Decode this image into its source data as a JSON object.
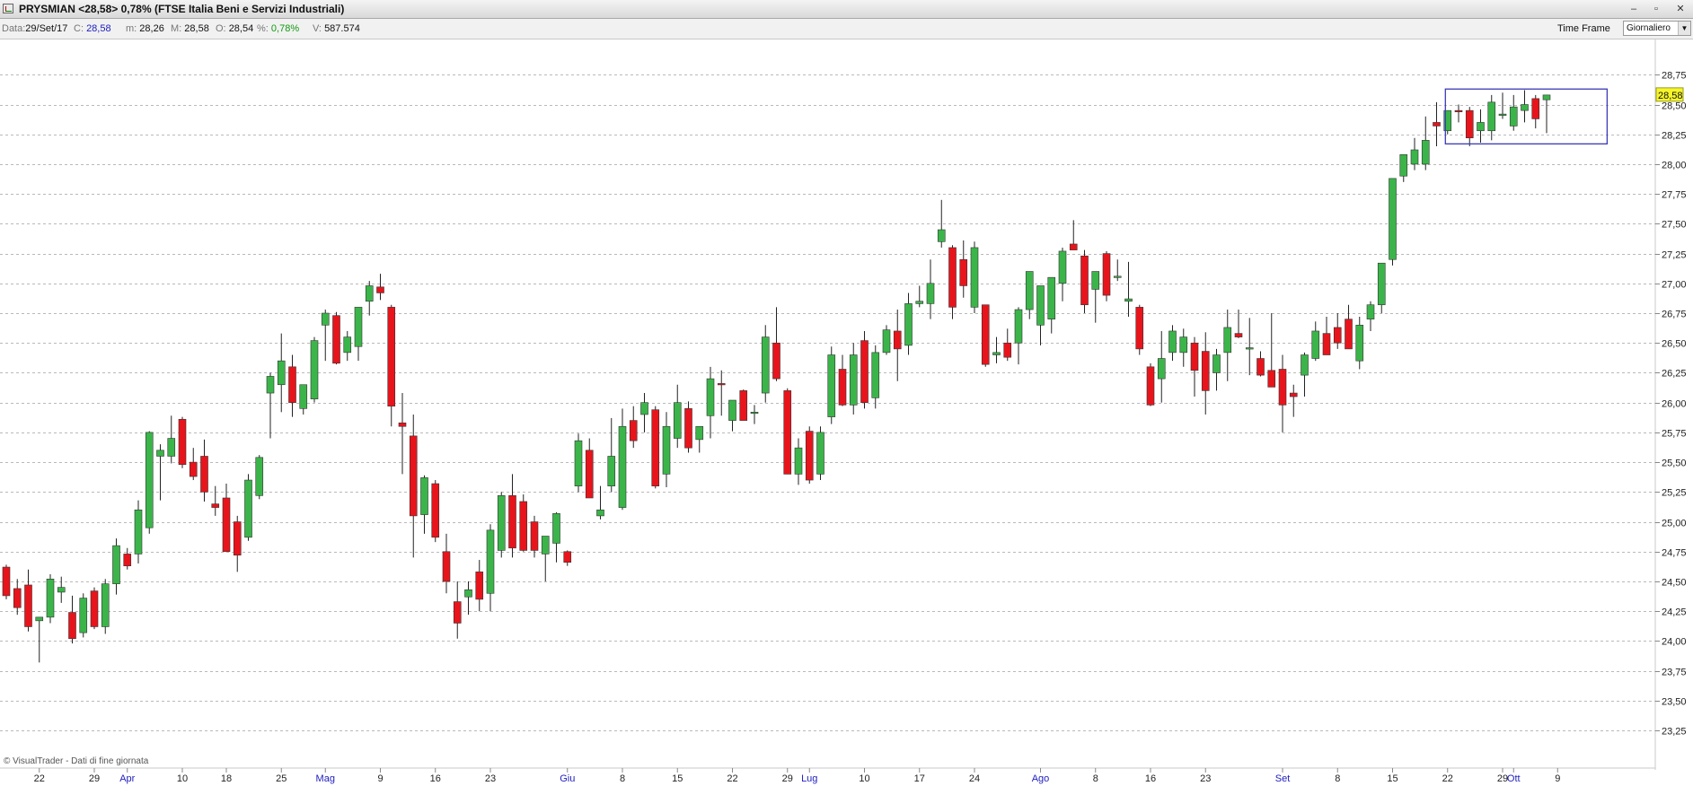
{
  "window": {
    "title": "PRYSMIAN <28,58> 0,78%  (FTSE Italia Beni e Servizi Industriali)",
    "minimize_label": "–",
    "maximize_label": "▫",
    "close_label": "✕"
  },
  "infobar": {
    "date_label": "Data:",
    "date_value": "29/Set/17",
    "close_label": "C:",
    "close_value": "28,58",
    "min_label": "m:",
    "min_value": "28,26",
    "max_label": "M:",
    "max_value": "28,58",
    "open_label": "O:",
    "open_value": "28,54",
    "pct_label": "%:",
    "pct_value": "0,78%",
    "vol_label": "V:",
    "vol_value": "587.574",
    "timeframe_label": "Time Frame",
    "timeframe_value": "Giornaliero"
  },
  "credit": "© VisualTrader - Dati di fine giornata",
  "colors": {
    "up": "#3bb54a",
    "down": "#e8141c",
    "grid": "#b9b9b9",
    "box": "#3a3ab8",
    "last_price_bg": "#f5f52a",
    "month_label": "#2020c0"
  },
  "chart_data": {
    "type": "candlestick",
    "last_price_label": "28,58",
    "ylim": [
      23.1,
      28.85
    ],
    "grid": true,
    "y_ticks": [
      "23,25",
      "23,50",
      "23,75",
      "24,00",
      "24,25",
      "24,50",
      "24,75",
      "25,00",
      "25,25",
      "25,50",
      "25,75",
      "26,00",
      "26,25",
      "26,50",
      "26,75",
      "27,00",
      "27,25",
      "27,50",
      "27,75",
      "28,00",
      "28,25",
      "28,50",
      "28,75"
    ],
    "x_ticks": [
      {
        "i": 3,
        "label": "22",
        "month": false
      },
      {
        "i": 8,
        "label": "29",
        "month": false
      },
      {
        "i": 11,
        "label": "Apr",
        "month": true
      },
      {
        "i": 16,
        "label": "10",
        "month": false
      },
      {
        "i": 20,
        "label": "18",
        "month": false
      },
      {
        "i": 25,
        "label": "25",
        "month": false
      },
      {
        "i": 29,
        "label": "Mag",
        "month": true
      },
      {
        "i": 34,
        "label": "9",
        "month": false
      },
      {
        "i": 39,
        "label": "16",
        "month": false
      },
      {
        "i": 44,
        "label": "23",
        "month": false
      },
      {
        "i": 51,
        "label": "Giu",
        "month": true
      },
      {
        "i": 56,
        "label": "8",
        "month": false
      },
      {
        "i": 61,
        "label": "15",
        "month": false
      },
      {
        "i": 66,
        "label": "22",
        "month": false
      },
      {
        "i": 71,
        "label": "29",
        "month": false
      },
      {
        "i": 73,
        "label": "Lug",
        "month": true
      },
      {
        "i": 78,
        "label": "10",
        "month": false
      },
      {
        "i": 83,
        "label": "17",
        "month": false
      },
      {
        "i": 88,
        "label": "24",
        "month": false
      },
      {
        "i": 94,
        "label": "Ago",
        "month": true
      },
      {
        "i": 99,
        "label": "8",
        "month": false
      },
      {
        "i": 104,
        "label": "16",
        "month": false
      },
      {
        "i": 109,
        "label": "23",
        "month": false
      },
      {
        "i": 116,
        "label": "Set",
        "month": true
      },
      {
        "i": 121,
        "label": "8",
        "month": false
      },
      {
        "i": 126,
        "label": "15",
        "month": false
      },
      {
        "i": 131,
        "label": "22",
        "month": false
      },
      {
        "i": 136,
        "label": "29",
        "month": false
      },
      {
        "i": 137,
        "label": "Ott",
        "month": true
      },
      {
        "i": 141,
        "label": "9",
        "month": false
      }
    ],
    "ohlc": [
      [
        24.62,
        24.64,
        24.35,
        24.38
      ],
      [
        24.44,
        24.52,
        24.22,
        24.28
      ],
      [
        24.47,
        24.6,
        24.08,
        24.12
      ],
      [
        24.17,
        24.2,
        23.82,
        24.2
      ],
      [
        24.2,
        24.56,
        24.15,
        24.52
      ],
      [
        24.41,
        24.54,
        24.32,
        24.45
      ],
      [
        24.24,
        24.38,
        23.98,
        24.02
      ],
      [
        24.07,
        24.4,
        24.03,
        24.36
      ],
      [
        24.42,
        24.45,
        24.1,
        24.12
      ],
      [
        24.12,
        24.52,
        24.06,
        24.48
      ],
      [
        24.48,
        24.86,
        24.39,
        24.8
      ],
      [
        24.73,
        24.78,
        24.6,
        24.63
      ],
      [
        24.73,
        25.18,
        24.65,
        25.1
      ],
      [
        24.95,
        25.76,
        24.9,
        25.75
      ],
      [
        25.55,
        25.65,
        25.18,
        25.6
      ],
      [
        25.55,
        25.89,
        25.49,
        25.7
      ],
      [
        25.86,
        25.88,
        25.45,
        25.48
      ],
      [
        25.5,
        25.62,
        25.35,
        25.38
      ],
      [
        25.55,
        25.69,
        25.17,
        25.25
      ],
      [
        25.15,
        25.3,
        25.05,
        25.12
      ],
      [
        25.2,
        25.32,
        24.75,
        24.75
      ],
      [
        25.0,
        25.05,
        24.58,
        24.72
      ],
      [
        24.87,
        25.4,
        24.84,
        25.35
      ],
      [
        25.22,
        25.56,
        25.19,
        25.54
      ],
      [
        26.08,
        26.25,
        25.7,
        26.22
      ],
      [
        26.15,
        26.58,
        25.92,
        26.35
      ],
      [
        26.3,
        26.4,
        25.88,
        26.0
      ],
      [
        25.95,
        26.15,
        25.9,
        26.15
      ],
      [
        26.03,
        26.55,
        26.0,
        26.52
      ],
      [
        26.65,
        26.78,
        26.35,
        26.75
      ],
      [
        26.73,
        26.76,
        26.32,
        26.33
      ],
      [
        26.42,
        26.6,
        26.35,
        26.55
      ],
      [
        26.47,
        26.75,
        26.35,
        26.8
      ],
      [
        26.85,
        27.02,
        26.73,
        26.98
      ],
      [
        26.97,
        27.08,
        26.86,
        26.92
      ],
      [
        26.8,
        26.82,
        25.8,
        25.97
      ],
      [
        25.83,
        26.08,
        25.4,
        25.8
      ],
      [
        25.72,
        25.9,
        24.7,
        25.05
      ],
      [
        25.06,
        25.39,
        24.9,
        25.37
      ],
      [
        25.32,
        25.35,
        24.83,
        24.87
      ],
      [
        24.75,
        24.9,
        24.4,
        24.5
      ],
      [
        24.33,
        24.5,
        24.02,
        24.15
      ],
      [
        24.37,
        24.5,
        24.22,
        24.43
      ],
      [
        24.58,
        24.68,
        24.25,
        24.35
      ],
      [
        24.4,
        24.98,
        24.25,
        24.93
      ],
      [
        24.76,
        25.25,
        24.7,
        25.22
      ],
      [
        25.22,
        25.4,
        24.7,
        24.78
      ],
      [
        25.17,
        25.23,
        24.75,
        24.76
      ],
      [
        25.0,
        25.05,
        24.7,
        24.76
      ],
      [
        24.73,
        24.85,
        24.5,
        24.88
      ],
      [
        24.82,
        25.08,
        24.66,
        25.07
      ],
      [
        24.75,
        24.76,
        24.63,
        24.66
      ],
      [
        25.3,
        25.74,
        25.25,
        25.68
      ],
      [
        25.6,
        25.7,
        25.2,
        25.2
      ],
      [
        25.05,
        25.3,
        25.02,
        25.1
      ],
      [
        25.3,
        25.87,
        25.25,
        25.55
      ],
      [
        25.12,
        25.95,
        25.1,
        25.8
      ],
      [
        25.85,
        25.97,
        25.62,
        25.68
      ],
      [
        25.9,
        26.08,
        25.75,
        26.0
      ],
      [
        25.94,
        25.97,
        25.28,
        25.3
      ],
      [
        25.4,
        25.92,
        25.29,
        25.8
      ],
      [
        25.7,
        26.15,
        25.62,
        26.0
      ],
      [
        25.95,
        26.01,
        25.58,
        25.62
      ],
      [
        25.69,
        25.8,
        25.58,
        25.8
      ],
      [
        25.89,
        26.3,
        25.7,
        26.2
      ],
      [
        26.16,
        26.27,
        25.89,
        26.15
      ],
      [
        25.85,
        25.9,
        25.76,
        26.02
      ],
      [
        26.1,
        26.11,
        25.85,
        25.85
      ],
      [
        25.92,
        25.98,
        25.82,
        25.92
      ],
      [
        26.08,
        26.65,
        26.0,
        26.55
      ],
      [
        26.5,
        26.8,
        26.18,
        26.2
      ],
      [
        26.1,
        26.12,
        25.4,
        25.4
      ],
      [
        25.4,
        25.7,
        25.31,
        25.62
      ],
      [
        25.76,
        25.8,
        25.32,
        25.35
      ],
      [
        25.4,
        25.8,
        25.35,
        25.75
      ],
      [
        25.88,
        26.47,
        25.82,
        26.4
      ],
      [
        26.28,
        26.4,
        25.97,
        25.98
      ],
      [
        25.98,
        26.5,
        25.9,
        26.4
      ],
      [
        26.52,
        26.6,
        25.95,
        26.0
      ],
      [
        26.04,
        26.48,
        25.95,
        26.42
      ],
      [
        26.42,
        26.65,
        26.4,
        26.61
      ],
      [
        26.6,
        26.78,
        26.18,
        26.45
      ],
      [
        26.48,
        26.92,
        26.4,
        26.83
      ],
      [
        26.83,
        26.98,
        26.8,
        26.85
      ],
      [
        26.83,
        27.2,
        26.7,
        27.0
      ],
      [
        27.35,
        27.7,
        27.3,
        27.45
      ],
      [
        27.3,
        27.32,
        26.7,
        26.8
      ],
      [
        27.2,
        27.36,
        26.88,
        26.98
      ],
      [
        26.8,
        27.35,
        26.75,
        27.3
      ],
      [
        26.82,
        26.82,
        26.3,
        26.32
      ],
      [
        26.4,
        26.55,
        26.33,
        26.42
      ],
      [
        26.5,
        26.62,
        26.35,
        26.38
      ],
      [
        26.5,
        26.8,
        26.32,
        26.78
      ],
      [
        26.78,
        27.07,
        26.7,
        27.1
      ],
      [
        26.65,
        26.95,
        26.48,
        26.98
      ],
      [
        26.7,
        27.05,
        26.58,
        27.05
      ],
      [
        27.0,
        27.3,
        26.85,
        27.27
      ],
      [
        27.33,
        27.53,
        27.28,
        27.28
      ],
      [
        27.23,
        27.28,
        26.75,
        26.82
      ],
      [
        26.95,
        27.1,
        26.67,
        27.1
      ],
      [
        27.25,
        27.27,
        26.85,
        26.9
      ],
      [
        27.05,
        27.2,
        27.02,
        27.06
      ],
      [
        26.85,
        27.18,
        26.72,
        26.87
      ],
      [
        26.8,
        26.82,
        26.4,
        26.45
      ],
      [
        26.3,
        26.33,
        25.97,
        25.98
      ],
      [
        26.2,
        26.6,
        26.0,
        26.37
      ],
      [
        26.42,
        26.65,
        26.35,
        26.6
      ],
      [
        26.42,
        26.62,
        26.3,
        26.55
      ],
      [
        26.5,
        26.55,
        26.05,
        26.27
      ],
      [
        26.43,
        26.59,
        25.9,
        26.1
      ],
      [
        26.25,
        26.45,
        26.1,
        26.4
      ],
      [
        26.42,
        26.78,
        26.18,
        26.63
      ],
      [
        26.58,
        26.78,
        26.54,
        26.55
      ],
      [
        26.45,
        26.71,
        26.23,
        26.46
      ],
      [
        26.37,
        26.43,
        26.22,
        26.23
      ],
      [
        26.27,
        26.75,
        26.2,
        26.13
      ],
      [
        26.28,
        26.4,
        25.75,
        25.98
      ],
      [
        26.08,
        26.15,
        25.88,
        26.05
      ],
      [
        26.23,
        26.42,
        26.05,
        26.4
      ],
      [
        26.37,
        26.68,
        26.35,
        26.6
      ],
      [
        26.58,
        26.72,
        26.5,
        26.4
      ],
      [
        26.63,
        26.75,
        26.45,
        26.5
      ],
      [
        26.7,
        26.82,
        26.45,
        26.45
      ],
      [
        26.35,
        26.72,
        26.28,
        26.65
      ],
      [
        26.7,
        26.85,
        26.6,
        26.82
      ],
      [
        26.82,
        27.1,
        26.75,
        27.17
      ],
      [
        27.2,
        27.3,
        27.15,
        27.88
      ],
      [
        27.9,
        27.95,
        27.85,
        28.08
      ],
      [
        28.0,
        28.22,
        27.95,
        28.12
      ],
      [
        28.0,
        28.4,
        27.95,
        28.2
      ],
      [
        28.35,
        28.52,
        28.15,
        28.32
      ],
      [
        28.28,
        28.45,
        28.25,
        28.45
      ],
      [
        28.45,
        28.5,
        28.35,
        28.44
      ],
      [
        28.45,
        28.48,
        28.15,
        28.22
      ],
      [
        28.28,
        28.46,
        28.18,
        28.35
      ],
      [
        28.28,
        28.58,
        28.2,
        28.52
      ],
      [
        28.42,
        28.6,
        28.38,
        28.42
      ],
      [
        28.32,
        28.58,
        28.28,
        28.48
      ],
      [
        28.45,
        28.62,
        28.35,
        28.5
      ],
      [
        28.55,
        28.58,
        28.3,
        28.38
      ],
      [
        28.54,
        28.58,
        28.26,
        28.58
      ]
    ],
    "highlight_range": {
      "i_start": 130.8,
      "i_end": 145.5,
      "y_low": 28.17,
      "y_high": 28.63
    }
  }
}
